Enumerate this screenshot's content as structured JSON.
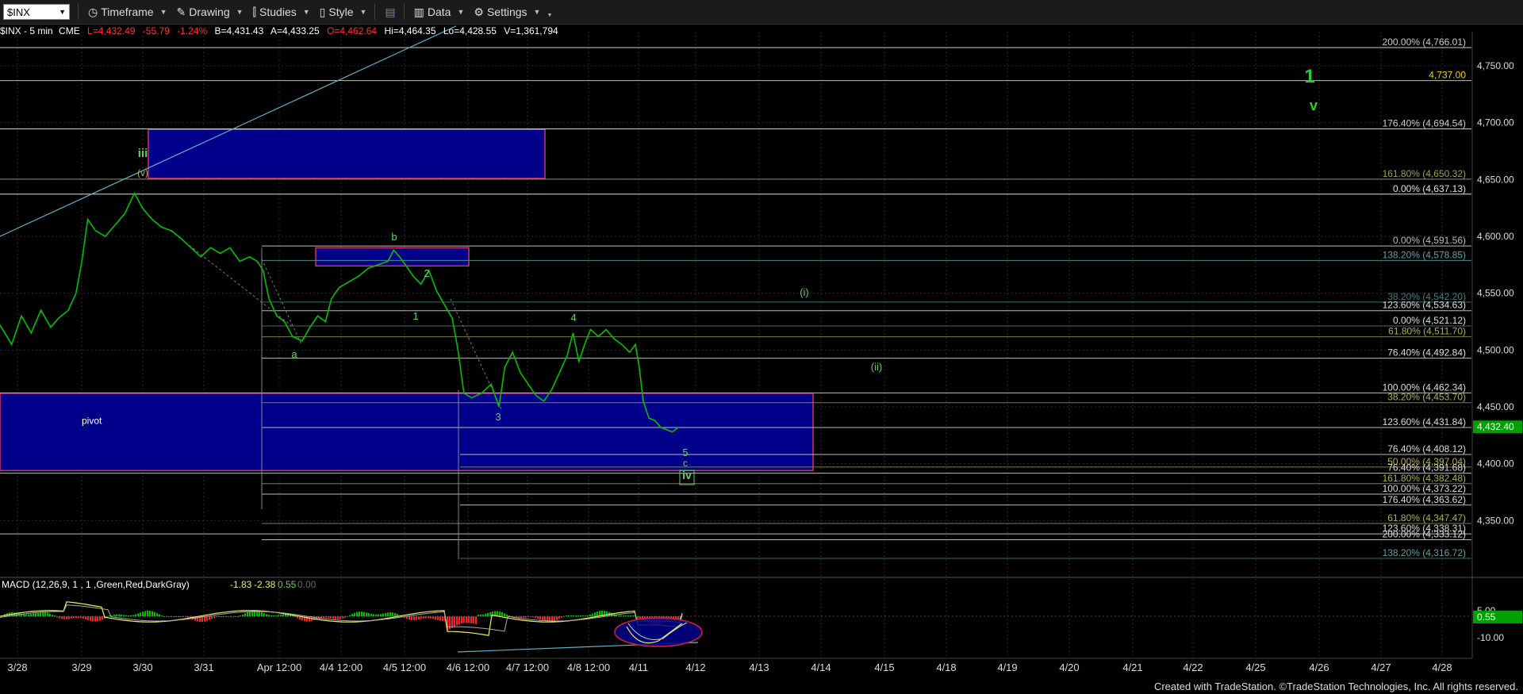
{
  "toolbar": {
    "symbol": "$INX",
    "items": [
      {
        "label": "Timeframe",
        "icon": "clock-icon"
      },
      {
        "label": "Drawing",
        "icon": "pencil-icon"
      },
      {
        "label": "Studies",
        "icon": "studies-icon"
      },
      {
        "label": "Style",
        "icon": "style-icon"
      },
      {
        "label": "Data",
        "icon": "data-icon"
      },
      {
        "label": "Settings",
        "icon": "gear-icon"
      }
    ]
  },
  "quote": {
    "symbol": "$INX - 5 min",
    "exchange": "CME",
    "last": "L=4,432.49",
    "change": "-55.79",
    "pct": "-1.24%",
    "bid": "B=4,431.43",
    "ask": "A=4,433.25",
    "open": "O=4,462.64",
    "high": "Hi=4,464.35",
    "low": "Lo=4,428.55",
    "volume": "V=1,361,794"
  },
  "macd": {
    "title": "MACD (12,26,9, 1 , 1 ,Green,Red,DarkGray)",
    "v1": "-1.83",
    "v2": "-2.38",
    "v3": "0.55",
    "v4": "0.00",
    "axis": [
      "5.00",
      "-10.00"
    ],
    "current": "0.55"
  },
  "footer": "Created with TradeStation. ©TradeStation Technologies, Inc. All rights reserved.",
  "colors": {
    "up": "#00c000",
    "down": "#ff2020",
    "box": "#00008b",
    "box_border": "#d0306a",
    "wave_label": "#5fd35f",
    "price_marker": "#00a000"
  },
  "chart_data": {
    "type": "line",
    "title": "$INX - 5 min",
    "y_axis": {
      "ticks": [
        4750,
        4700,
        4650,
        4600,
        4550,
        4500,
        4450,
        4400,
        4350
      ],
      "tick_labels": [
        "4,750.00",
        "4,700.00",
        "4,650.00",
        "4,600.00",
        "4,550.00",
        "4,500.00",
        "4,450.00",
        "4,400.00",
        "4,350.00"
      ],
      "range": [
        4300,
        4780
      ]
    },
    "x_axis": {
      "labels": [
        "3/28",
        "3/29",
        "3/30",
        "3/31",
        "Apr 12:00",
        "4/4 12:00",
        "4/5 12:00",
        "4/6 12:00",
        "4/7 12:00",
        "4/8 12:00",
        "4/11",
        "4/12",
        "4/13",
        "4/14",
        "4/15",
        "4/18",
        "4/19",
        "4/20",
        "4/21",
        "4/22",
        "4/25",
        "4/26",
        "4/27",
        "4/28"
      ]
    },
    "price_marker": "4,432.40",
    "price_series": [
      [
        0,
        4522
      ],
      [
        12,
        4505
      ],
      [
        22,
        4530
      ],
      [
        32,
        4515
      ],
      [
        42,
        4535
      ],
      [
        52,
        4520
      ],
      [
        60,
        4528
      ],
      [
        70,
        4535
      ],
      [
        78,
        4550
      ],
      [
        84,
        4578
      ],
      [
        90,
        4615
      ],
      [
        98,
        4605
      ],
      [
        108,
        4600
      ],
      [
        118,
        4610
      ],
      [
        128,
        4620
      ],
      [
        138,
        4638
      ],
      [
        146,
        4625
      ],
      [
        156,
        4615
      ],
      [
        166,
        4608
      ],
      [
        176,
        4605
      ],
      [
        186,
        4598
      ],
      [
        196,
        4590
      ],
      [
        206,
        4582
      ],
      [
        216,
        4590
      ],
      [
        226,
        4585
      ],
      [
        236,
        4590
      ],
      [
        246,
        4578
      ],
      [
        256,
        4582
      ],
      [
        264,
        4578
      ],
      [
        270,
        4570
      ],
      [
        276,
        4545
      ],
      [
        284,
        4530
      ],
      [
        292,
        4525
      ],
      [
        300,
        4512
      ],
      [
        310,
        4508
      ],
      [
        318,
        4520
      ],
      [
        326,
        4530
      ],
      [
        334,
        4525
      ],
      [
        340,
        4545
      ],
      [
        348,
        4555
      ],
      [
        358,
        4560
      ],
      [
        368,
        4565
      ],
      [
        378,
        4572
      ],
      [
        388,
        4575
      ],
      [
        398,
        4578
      ],
      [
        404,
        4588
      ],
      [
        410,
        4582
      ],
      [
        416,
        4575
      ],
      [
        424,
        4565
      ],
      [
        432,
        4558
      ],
      [
        440,
        4570
      ],
      [
        448,
        4552
      ],
      [
        456,
        4540
      ],
      [
        464,
        4528
      ],
      [
        470,
        4500
      ],
      [
        476,
        4462
      ],
      [
        484,
        4458
      ],
      [
        494,
        4462
      ],
      [
        504,
        4470
      ],
      [
        512,
        4450
      ],
      [
        518,
        4485
      ],
      [
        526,
        4498
      ],
      [
        534,
        4480
      ],
      [
        542,
        4470
      ],
      [
        550,
        4460
      ],
      [
        558,
        4455
      ],
      [
        566,
        4465
      ],
      [
        574,
        4480
      ],
      [
        582,
        4495
      ],
      [
        588,
        4515
      ],
      [
        594,
        4490
      ],
      [
        600,
        4505
      ],
      [
        606,
        4518
      ],
      [
        614,
        4512
      ],
      [
        622,
        4518
      ],
      [
        630,
        4510
      ],
      [
        638,
        4505
      ],
      [
        646,
        4498
      ],
      [
        652,
        4505
      ],
      [
        656,
        4485
      ],
      [
        660,
        4455
      ],
      [
        666,
        4440
      ],
      [
        672,
        4438
      ],
      [
        678,
        4432
      ],
      [
        684,
        4430
      ],
      [
        690,
        4428
      ],
      [
        696,
        4432
      ]
    ],
    "levels": [
      {
        "label": "200.00% (4,766.01)",
        "value": 4766.01
      },
      {
        "label": "4,737.00",
        "value": 4737.0
      },
      {
        "label": "176.40% (4,694.54)",
        "value": 4694.54
      },
      {
        "label": "161.80% (4,650.32)",
        "value": 4650.32
      },
      {
        "label": "0.00% (4,637.13)",
        "value": 4637.13
      },
      {
        "label": "0.00% (4,591.56)",
        "value": 4591.56
      },
      {
        "label": "138.20% (4,578.85)",
        "value": 4578.85
      },
      {
        "label": "38.20% (4,542.20)",
        "value": 4542.2
      },
      {
        "label": "123.60% (4,534.63)",
        "value": 4534.63
      },
      {
        "label": "0.00% (4,521.12)",
        "value": 4521.12
      },
      {
        "label": "61.80% (4,511.70)",
        "value": 4511.7
      },
      {
        "label": "76.40% (4,492.84)",
        "value": 4492.84
      },
      {
        "label": "100.00% (4,462.34)",
        "value": 4462.34
      },
      {
        "label": "38.20% (4,453.70)",
        "value": 4453.7
      },
      {
        "label": "123.60% (4,431.84)",
        "value": 4431.84
      },
      {
        "label": "76.40% (4,408.12)",
        "value": 4408.12
      },
      {
        "label": "50.00% (4,397.04)",
        "value": 4397.04
      },
      {
        "label": "76.40% (4,391.68)",
        "value": 4391.68
      },
      {
        "label": "161.80% (4,382.48)",
        "value": 4382.48
      },
      {
        "label": "100.00% (4,373.22)",
        "value": 4373.22
      },
      {
        "label": "176.40% (4,363.62)",
        "value": 4363.62
      },
      {
        "label": "61.80% (4,347.47)",
        "value": 4347.47
      },
      {
        "label": "123.60% (4,338.31)",
        "value": 4338.31
      },
      {
        "label": "200.00% (4,333.12)",
        "value": 4333.12
      },
      {
        "label": "138.20% (4,316.72)",
        "value": 4316.72
      }
    ],
    "wave_labels": [
      "iii",
      "(v)",
      "b",
      "2",
      "1",
      "a",
      "3",
      "4",
      "5",
      "c",
      "iv",
      "(i)",
      "(ii)",
      "1",
      "v"
    ],
    "annotations": [
      "pivot"
    ]
  }
}
